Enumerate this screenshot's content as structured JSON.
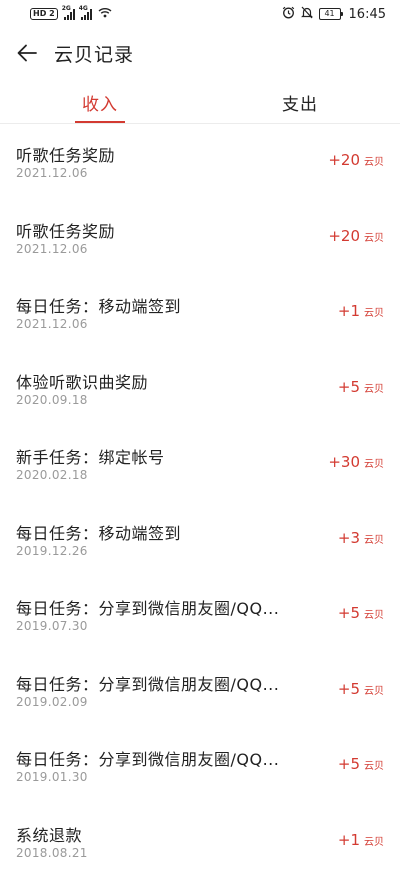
{
  "status_bar": {
    "hd_label": "HD",
    "hd_num": "2",
    "signal1_tag": "2G",
    "signal2_tag": "4G",
    "battery": "41",
    "time": "16:45"
  },
  "header": {
    "title": "云贝记录"
  },
  "tabs": {
    "income": "收入",
    "expense": "支出"
  },
  "unit_label": "云贝",
  "records": [
    {
      "title": "听歌任务奖励",
      "date": "2021.12.06",
      "amount": "+20"
    },
    {
      "title": "听歌任务奖励",
      "date": "2021.12.06",
      "amount": "+20"
    },
    {
      "title": "每日任务：移动端签到",
      "date": "2021.12.06",
      "amount": "+1"
    },
    {
      "title": "体验听歌识曲奖励",
      "date": "2020.09.18",
      "amount": "+5"
    },
    {
      "title": "新手任务：绑定帐号",
      "date": "2020.02.18",
      "amount": "+30"
    },
    {
      "title": "每日任务：移动端签到",
      "date": "2019.12.26",
      "amount": "+3"
    },
    {
      "title": "每日任务：分享到微信朋友圈/QQ...",
      "date": "2019.07.30",
      "amount": "+5"
    },
    {
      "title": "每日任务：分享到微信朋友圈/QQ...",
      "date": "2019.02.09",
      "amount": "+5"
    },
    {
      "title": "每日任务：分享到微信朋友圈/QQ...",
      "date": "2019.01.30",
      "amount": "+5"
    },
    {
      "title": "系统退款",
      "date": "2018.08.21",
      "amount": "+1"
    }
  ],
  "colors": {
    "accent": "#d33a31",
    "text": "#222222",
    "secondary": "#9a9a9a"
  }
}
